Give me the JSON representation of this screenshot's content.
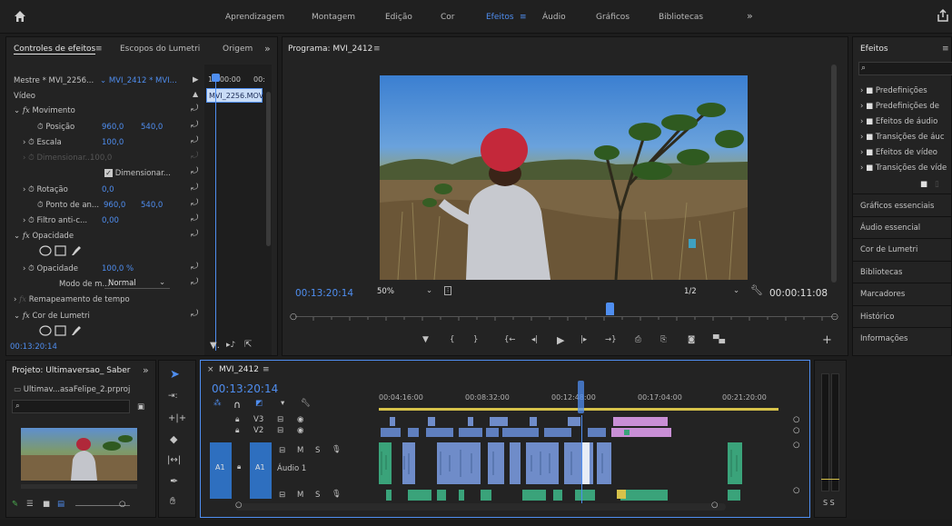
{
  "workspaces": {
    "items": [
      {
        "label": "Aprendizagem"
      },
      {
        "label": "Montagem"
      },
      {
        "label": "Edição"
      },
      {
        "label": "Cor"
      },
      {
        "label": "Efeitos"
      },
      {
        "label": "Áudio"
      },
      {
        "label": "Gráficos"
      },
      {
        "label": "Bibliotecas"
      }
    ],
    "active": "Efeitos",
    "more": "»"
  },
  "effect_controls": {
    "tabs": [
      "Controles de efeitos",
      "Escopos do Lumetri",
      "Origem"
    ],
    "more": "»",
    "master_label": "Mestre * MVI_2256...",
    "sequence_label": "MVI_2412 * MVI...",
    "timecode_ruler": "13:00:00",
    "ruler_end": "00:",
    "clip_name": "MVI_2256.MOV",
    "section_video": "Vídeo",
    "motion": {
      "label": "Movimento",
      "position": {
        "label": "Posição",
        "x": "960,0",
        "y": "540,0"
      },
      "scale": {
        "label": "Escala",
        "value": "100,0"
      },
      "scale_width": {
        "label": "Dimensionar...",
        "value": "100,0"
      },
      "uniform_scale": "Dimensionar...",
      "rotation": {
        "label": "Rotação",
        "value": "0,0"
      },
      "anchor": {
        "label": "Ponto de an...",
        "x": "960,0",
        "y": "540,0"
      },
      "antiflicker": {
        "label": "Filtro anti-c...",
        "value": "0,00"
      }
    },
    "opacity": {
      "label": "Opacidade",
      "value_label": "Opacidade",
      "value": "100,0 %",
      "blend_label": "Modo de m...",
      "blend_value": "Normal"
    },
    "time_remap": "Remapeamento de tempo",
    "lumetri": "Cor de Lumetri",
    "current_time": "00:13:20:14"
  },
  "program_monitor": {
    "title": "Programa: MVI_2412",
    "timecode": "00:13:20:14",
    "zoom": "50%",
    "resolution": "1/2",
    "duration": "00:00:11:08"
  },
  "effects_panel": {
    "title": "Efeitos",
    "folders": [
      "Predefinições",
      "Predefinições de",
      "Efeitos de áudio",
      "Transições de áuc",
      "Efeitos de vídeo",
      "Transições de víde"
    ],
    "sections": [
      "Gráficos essenciais",
      "Áudio essencial",
      "Cor de Lumetri",
      "Bibliotecas",
      "Marcadores",
      "Histórico",
      "Informações"
    ]
  },
  "project_panel": {
    "title": "Projeto: Ultimaversao_ Saber",
    "more": "»",
    "file": "Ultimav...asaFelipe_2.prproj"
  },
  "timeline": {
    "title": "MVI_2412",
    "timecode": "00:13:20:14",
    "ruler": [
      "00:04:16:00",
      "00:08:32:00",
      "00:12:48:00",
      "00:17:04:00",
      "00:21:20:00"
    ],
    "tracks": {
      "v3": "V3",
      "v2": "V2",
      "a1": "A1",
      "audio_name": "Áudio 1",
      "m": "M",
      "s": "S"
    }
  },
  "meters": {
    "labels": "S S"
  },
  "colors": {
    "accent": "#4f8ef0",
    "panel": "#232323",
    "clip_video": "#5f7fbf",
    "clip_audio": "#3aa37a",
    "clip_pink": "#c98fd6",
    "playhead": "#4f8ef0"
  }
}
